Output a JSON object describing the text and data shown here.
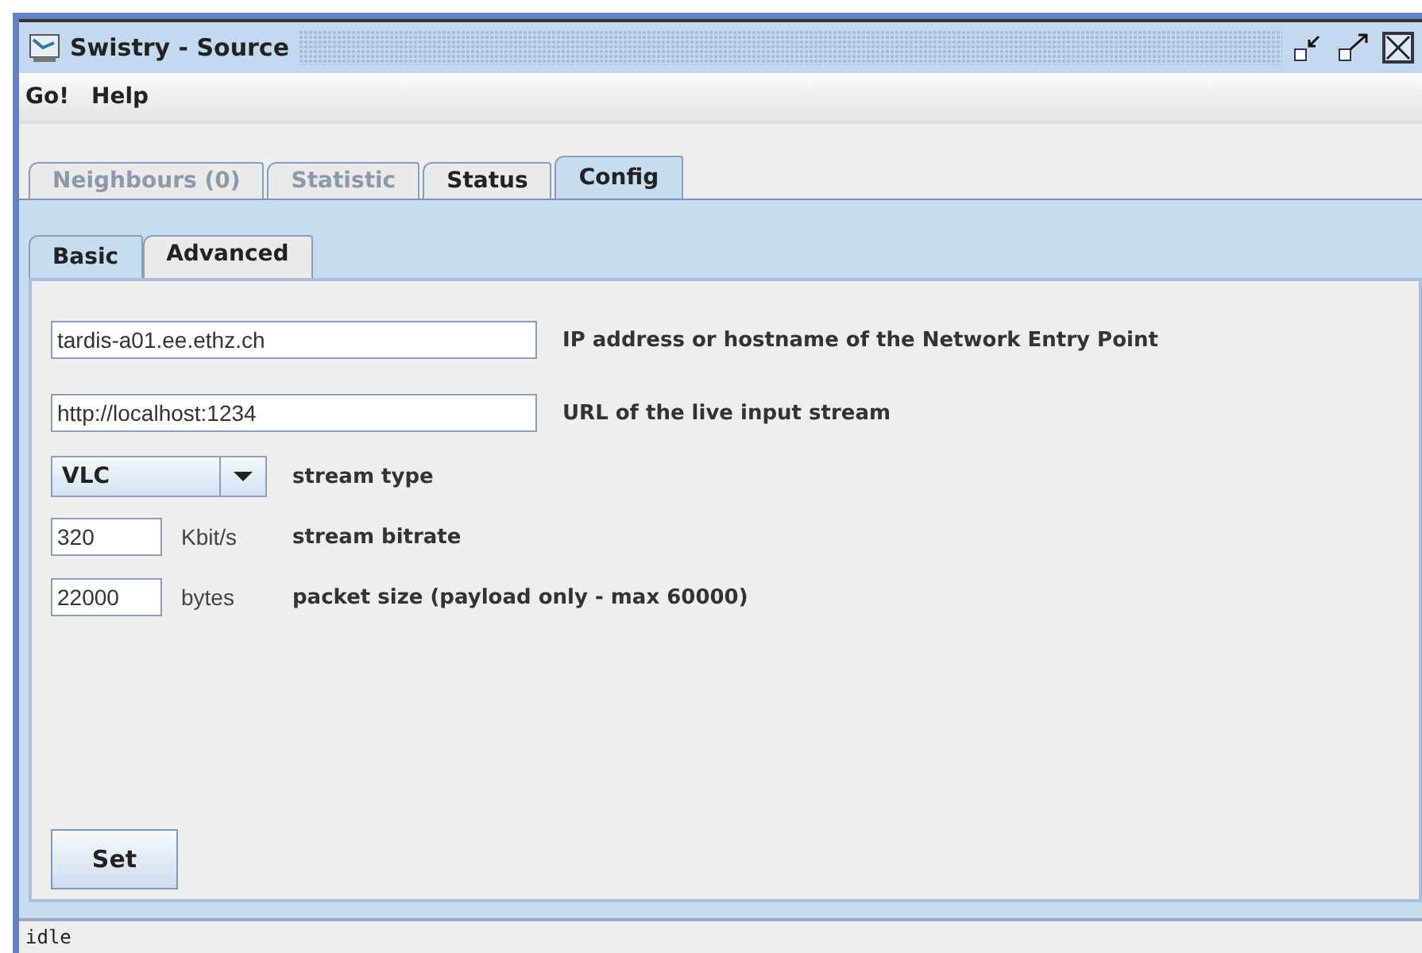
{
  "window": {
    "title": "Swistry - Source"
  },
  "menu": [
    "Go!",
    "Help"
  ],
  "tabs": [
    {
      "label": "Neighbours (0)",
      "selected": false,
      "disabled": true
    },
    {
      "label": "Statistic",
      "selected": false,
      "disabled": true
    },
    {
      "label": "Status",
      "selected": false,
      "disabled": false
    },
    {
      "label": "Config",
      "selected": true,
      "disabled": false
    }
  ],
  "subtabs": [
    {
      "label": "Basic",
      "selected": true
    },
    {
      "label": "Advanced",
      "selected": false
    }
  ],
  "rows": [
    {
      "kind": "wide",
      "value": "tardis-a01.ee.ethz.ch",
      "label": "IP address or hostname of the Network Entry Point"
    },
    {
      "kind": "wide",
      "value": "http://localhost:1234",
      "label": "URL of the live input stream"
    },
    {
      "kind": "combo",
      "value": "VLC",
      "label": "stream type"
    },
    {
      "kind": "unit",
      "value": "320",
      "unit": "Kbit/s",
      "label": "stream bitrate"
    },
    {
      "kind": "unit",
      "value": "22000",
      "unit": "bytes",
      "label": "packet size (payload only - max 60000)"
    }
  ],
  "button": "Set",
  "status_bar": "idle"
}
